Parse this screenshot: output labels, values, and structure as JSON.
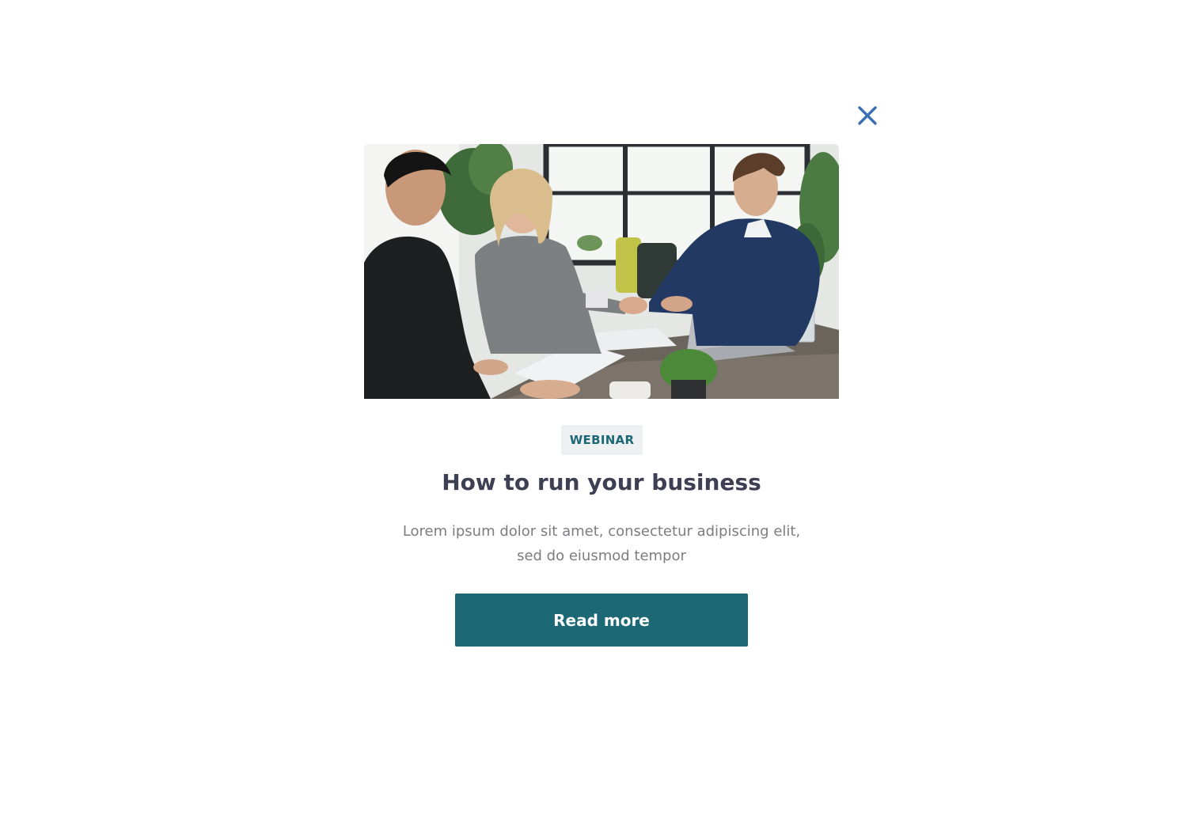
{
  "modal": {
    "close_icon": "close-icon",
    "image_description_icon": "meeting-photo",
    "badge": "WEBINAR",
    "title": "How to run your business",
    "description": "Lorem ipsum dolor sit amet, consectetur adipiscing elit, sed do eiusmod tempor",
    "cta_label": "Read more"
  },
  "colors": {
    "accent": "#1d6875",
    "close": "#3a6fb5",
    "title": "#3d3f52",
    "body_text": "#7c7d82",
    "badge_bg": "#eef0f1"
  }
}
